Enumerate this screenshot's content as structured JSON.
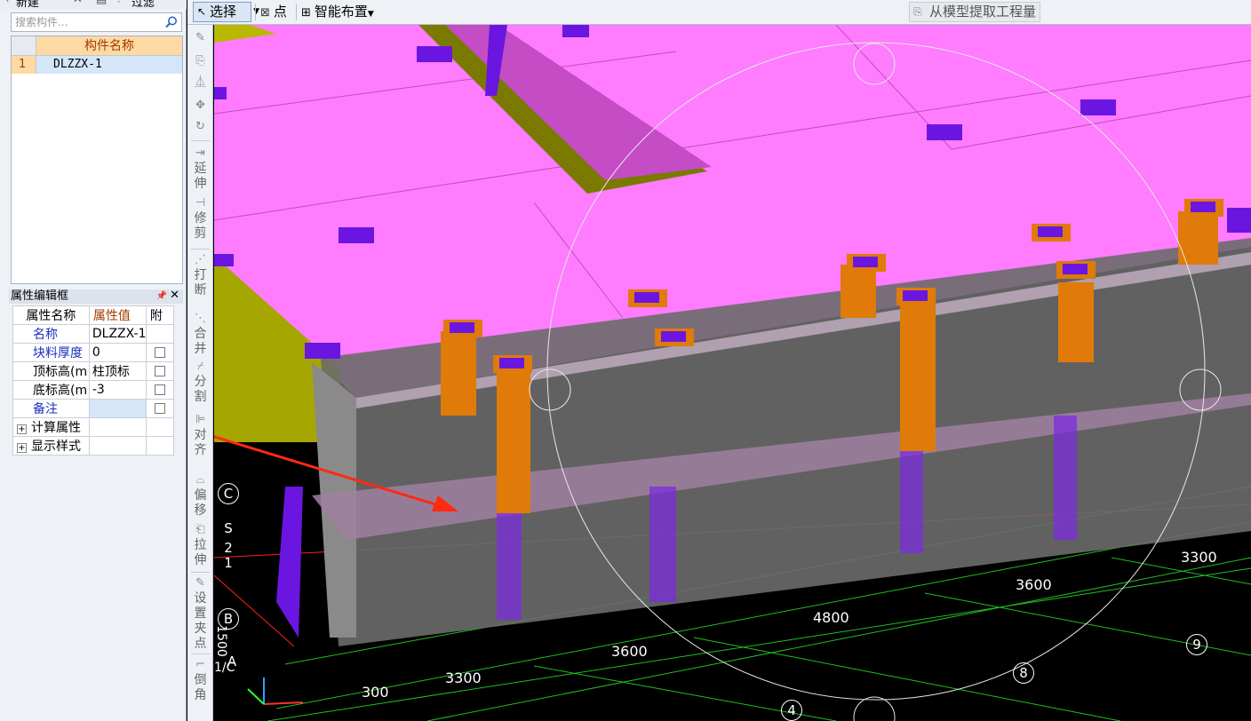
{
  "top_left_toolbar": {
    "new_label": "新建",
    "filter_label": "过滤"
  },
  "search": {
    "placeholder": "搜索构件..."
  },
  "component_list": {
    "header": "构件名称",
    "rows": [
      {
        "num": "1",
        "name": "DLZZX-1"
      }
    ]
  },
  "property_editor": {
    "title": "属性编辑框",
    "col_name": "属性名称",
    "col_value": "属性值",
    "col_attach": "附",
    "rows": [
      {
        "name": "名称",
        "value": "DLZZX-1"
      },
      {
        "name": "块料厚度",
        "value": "0"
      },
      {
        "name": "顶标高(m",
        "value": "柱顶标"
      },
      {
        "name": "底标高(m",
        "value": "-3"
      },
      {
        "name": "备注",
        "value": ""
      },
      {
        "name": "计算属性",
        "value": ""
      },
      {
        "name": "显示样式",
        "value": ""
      }
    ]
  },
  "toolbar": {
    "select_label": "选择",
    "point_label": "点",
    "smart_layout_label": "智能布置",
    "extract_label": "从模型提取工程量"
  },
  "vertical_toolbar": {
    "extend": "延伸",
    "trim": "修剪",
    "break": "打断",
    "merge": "合并",
    "split": "分割",
    "align": "对齐",
    "offset": "偏移",
    "stretch": "拉伸",
    "set_grip": "设置夹点",
    "chamfer": "倒角"
  },
  "viewport": {
    "dimensions": [
      "3300",
      "3600",
      "4800",
      "3600",
      "3300",
      "300"
    ],
    "axis_labels": [
      "C",
      "S",
      "2",
      "1",
      "B",
      "A",
      "9",
      "8",
      "4"
    ],
    "rotated_labels": [
      "1500",
      "1/C"
    ]
  },
  "colors": {
    "slab": "#ff7cff",
    "column": "#e07a08",
    "cap": "#6b16e0",
    "beam": "#b8b800",
    "arrow": "#ff2a10"
  }
}
